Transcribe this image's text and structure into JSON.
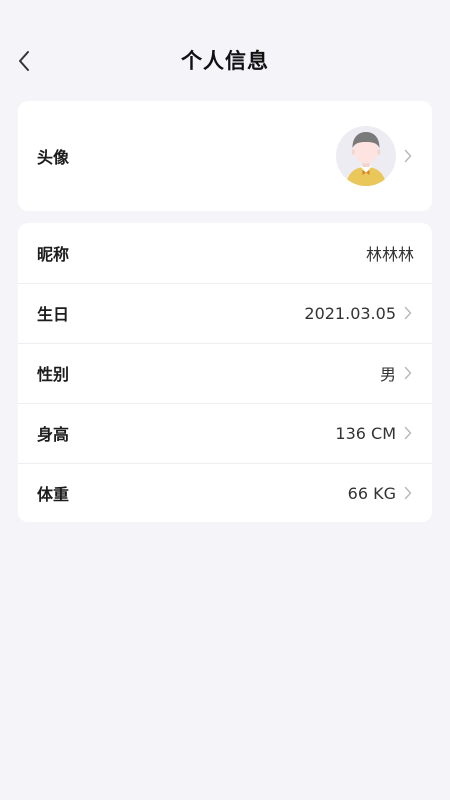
{
  "header": {
    "title": "个人信息"
  },
  "avatar_section": {
    "label": "头像",
    "icon": "user-avatar"
  },
  "profile": {
    "rows": [
      {
        "key": "nickname",
        "label": "昵称",
        "value": "林林林",
        "has_chevron": false
      },
      {
        "key": "birthday",
        "label": "生日",
        "value": "2021.03.05",
        "has_chevron": true
      },
      {
        "key": "gender",
        "label": "性别",
        "value": "男",
        "has_chevron": true
      },
      {
        "key": "height",
        "label": "身高",
        "value": "136 CM",
        "has_chevron": true
      },
      {
        "key": "weight",
        "label": "体重",
        "value": "66 KG",
        "has_chevron": true
      }
    ]
  },
  "colors": {
    "background": "#f4f4f9",
    "card": "#ffffff",
    "chevron": "#b9b9bf",
    "avatar_shirt": "#e9c75a",
    "avatar_hair": "#7a7a7a",
    "avatar_skin": "#fde4e0"
  }
}
